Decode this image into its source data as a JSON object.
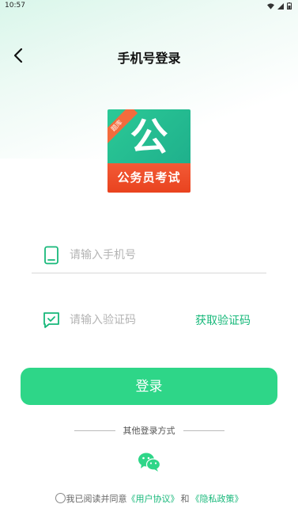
{
  "status_bar": {
    "time": "10:57"
  },
  "header": {
    "title": "手机号登录"
  },
  "logo": {
    "badge": "题库",
    "char": "公",
    "text": "公务员考试"
  },
  "phone_field": {
    "placeholder": "请输入手机号",
    "value": ""
  },
  "code_field": {
    "placeholder": "请输入验证码",
    "value": "",
    "get_code_label": "获取验证码"
  },
  "login_button": {
    "label": "登录"
  },
  "other_login": {
    "label": "其他登录方式"
  },
  "agreement": {
    "prefix": "我已阅读并同意",
    "user_agreement": "《用户协议》",
    "and": "和",
    "privacy_policy": "《隐私政策》"
  },
  "colors": {
    "accent": "#2ed688",
    "link": "#17b87a",
    "logo_green": "#2bc996",
    "logo_orange": "#f25a36"
  }
}
